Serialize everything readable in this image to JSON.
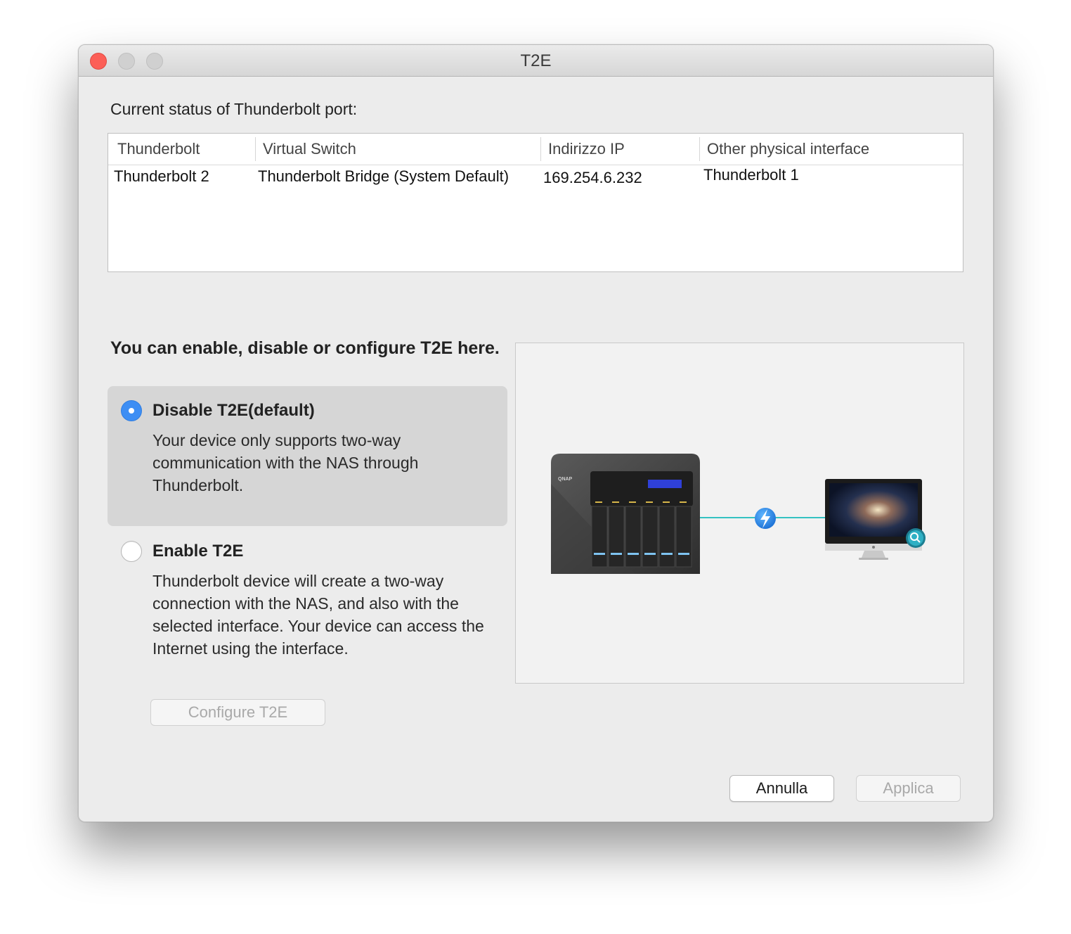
{
  "window": {
    "title": "T2E"
  },
  "status": {
    "label": "Current status of Thunderbolt port:",
    "columns": [
      "Thunderbolt",
      "Virtual Switch",
      "Indirizzo IP",
      "Other physical interface"
    ],
    "rows": [
      [
        "Thunderbolt 2",
        "Thunderbolt Bridge (System Default)",
        "169.254.6.232",
        "Thunderbolt 1"
      ]
    ]
  },
  "config": {
    "heading": "You can enable, disable or configure T2E here.",
    "options": [
      {
        "title": "Disable T2E(default)",
        "description": "Your device only supports two-way communication with the NAS through Thunderbolt.",
        "selected": true
      },
      {
        "title": "Enable T2E",
        "description": "Thunderbolt device will create a two-way connection with the NAS, and also with the selected interface. Your device can access the Internet using the interface.",
        "selected": false
      }
    ],
    "configure_button": "Configure T2E"
  },
  "diagram": {
    "nas_brand": "QNAP",
    "connector_icon": "thunderbolt-icon",
    "client_device": "imac-icon",
    "client_badge": "qfinder-search-icon"
  },
  "footer": {
    "cancel_label": "Annulla",
    "apply_label": "Applica"
  },
  "colors": {
    "accent": "#3d8ef4",
    "close_button": "#fc5f57",
    "link_line": "#35c2c2"
  }
}
